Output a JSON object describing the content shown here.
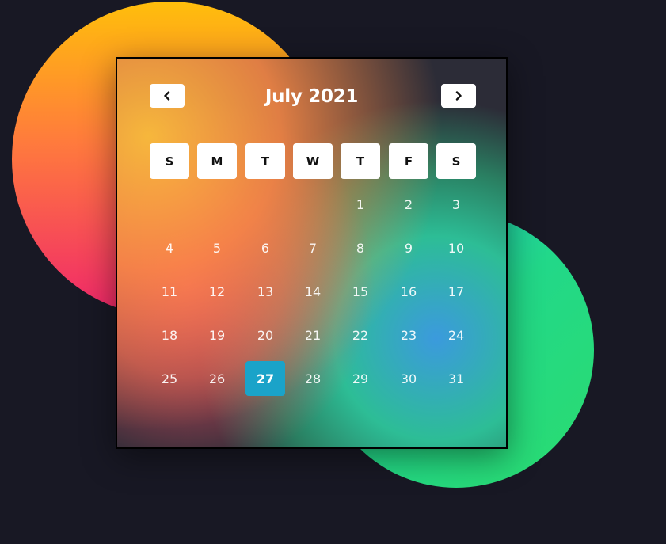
{
  "calendar": {
    "title": "July 2021",
    "prev_icon": "chevron-left-icon",
    "next_icon": "chevron-right-icon",
    "weekdays": [
      "S",
      "M",
      "T",
      "W",
      "T",
      "F",
      "S"
    ],
    "days": [
      "1",
      "2",
      "3",
      "4",
      "5",
      "6",
      "7",
      "8",
      "9",
      "10",
      "11",
      "12",
      "13",
      "14",
      "15",
      "16",
      "17",
      "18",
      "19",
      "20",
      "21",
      "22",
      "23",
      "24",
      "25",
      "26",
      "27",
      "28",
      "29",
      "30",
      "31"
    ],
    "first_weekday_index": 4,
    "selected_day": "27",
    "accent_color": "#1aa3c9"
  },
  "background": {
    "page_color": "#181824",
    "orange_blob_colors": [
      "#ffbe0b",
      "#ff7a3d",
      "#f0266b"
    ],
    "green_blob_colors": [
      "#1fc6d8",
      "#22d889",
      "#2bdc6e"
    ]
  }
}
